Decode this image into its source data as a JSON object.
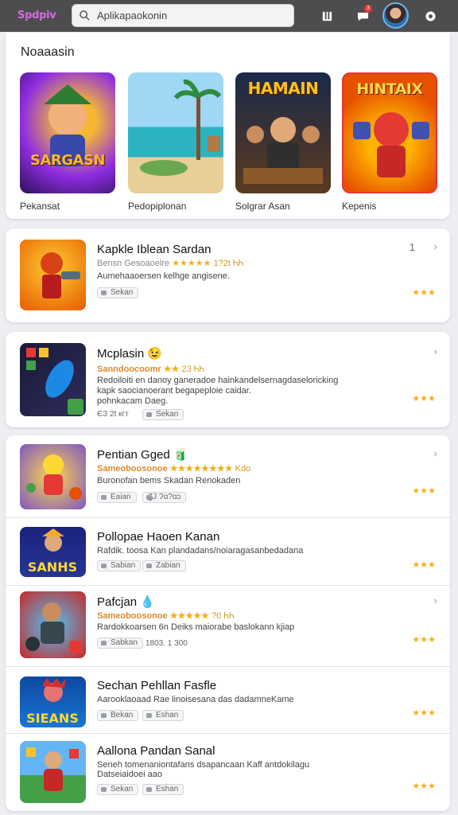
{
  "header": {
    "logo": "Spdpiv",
    "search_placeholder": "Aplikapaokonin",
    "notification_count": "3",
    "icons": [
      "search-icon",
      "bookmark-icon",
      "chat-icon",
      "settings-icon"
    ]
  },
  "featured": {
    "heading": "Noaaasin",
    "items": [
      {
        "art_title": "SARGASN",
        "label": "Pekansat"
      },
      {
        "art_title": "",
        "label": "Pedopiplonan"
      },
      {
        "art_title": "HAMAIN",
        "label": "Solgrar Asan"
      },
      {
        "art_title": "HINTAIX",
        "label": "Kepenis"
      }
    ]
  },
  "list": [
    {
      "title": "Kapkle Iblean Sardan",
      "meta_text": "Bensn Gesoaoelre",
      "meta_stars": "★★★★★",
      "meta_score": "1?2t ᏂᏂ",
      "desc": [
        "Aumehaaoersen kelhge angisene."
      ],
      "chips": [
        "Sekan"
      ],
      "rating": "★★★",
      "number": "1"
    },
    {
      "title": "Mcplasin 😉",
      "meta_text": "Sanndoocoomr",
      "meta_stars": "★★",
      "meta_score": "23 ᏂᏂ",
      "desc": [
        "Redoiloiti en danoy ganeradoe hainkandelsernagdaseloricking",
        "kapk saocianoerant begapeploie caidar.",
        "pohnkacam Daeg."
      ],
      "chips": [
        "Sekan"
      ],
      "chips_prefix": "ЄЗ 2t кгт",
      "rating": "★★★"
    },
    {
      "title": "Pentian Gged 🧃",
      "meta_text": "Sameoboosonoe",
      "meta_stars": "★★★★★★★★",
      "meta_score": "Kdo",
      "desc": [
        "Buronofan bems Skadan Renokaden"
      ],
      "chips": [
        "Eaian"
      ],
      "chips_prefix2": "ƷJ Ɂɑ?ɑɔ",
      "rating": "★★★"
    },
    {
      "title": "Pollopae Haoen Kanan",
      "meta_text": "",
      "desc": [
        "Rafdik. toosa Kan plandadans/noiaragasanbedadana"
      ],
      "chips": [
        "Sabian",
        "Zabian"
      ],
      "rating": "★★★"
    },
    {
      "title": "Pafcjan 💧",
      "meta_text": "Sameoboosonoe",
      "meta_stars": "★★★★★",
      "meta_score": "?0 ᏂᏂ",
      "desc": [
        "Rardokkoarsen 6n Deiks maiorabe baslokann kjiap"
      ],
      "chips": [
        "Sabkan"
      ],
      "chips_prefix2": "1803. 1 300",
      "rating": "★★★"
    },
    {
      "title": "Sechan Pehllan Fasfle",
      "meta_text": "",
      "desc": [
        "Aarooklaoaad Rae linoisesana das dadamneKame"
      ],
      "chips": [
        "Bekan",
        "Eshan"
      ],
      "rating": "★★★"
    },
    {
      "title": "Aallona Pandan Sanal",
      "meta_text": "",
      "desc": [
        "Seneh tomenaniontafans dsapancaan Kaff antdokilagu",
        "Datseiaidoei aao"
      ],
      "chips": [
        "Sekan",
        "Eshan"
      ],
      "rating": "★★★"
    }
  ],
  "colors": {
    "header_bg": "#4d4d4f",
    "logo": "#d66be0",
    "star": "#f2b01e",
    "meta": "#e0892e"
  }
}
